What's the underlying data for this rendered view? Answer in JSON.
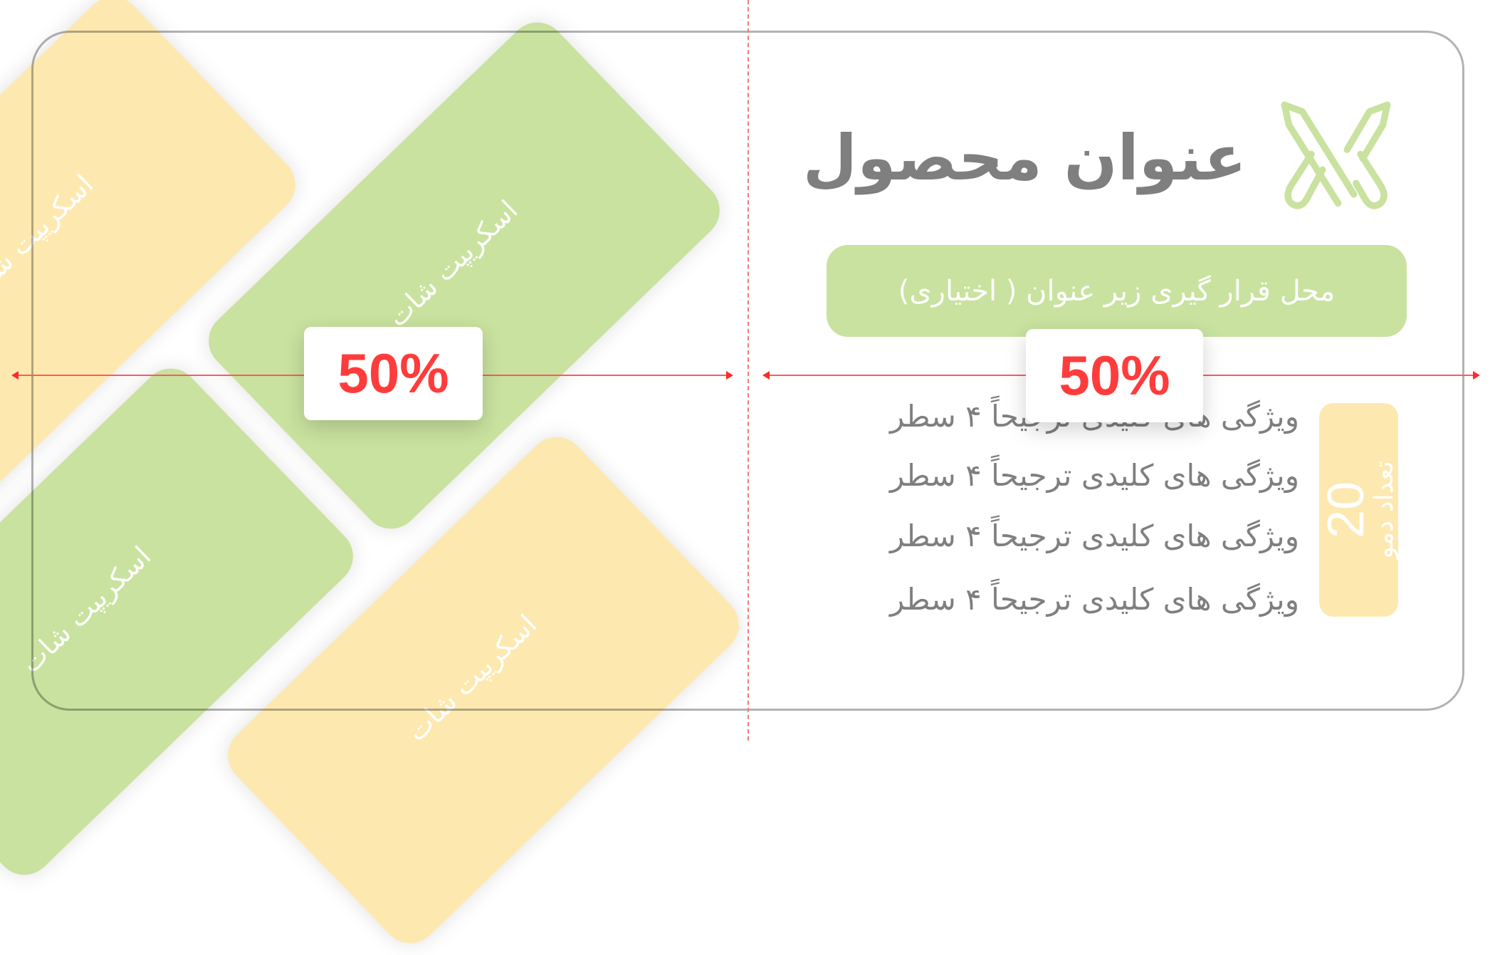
{
  "colors": {
    "green": "#c9e29f",
    "yellow": "#fde9b0",
    "title_gray": "#7f7f7f",
    "discount_red": "#ff3c3c",
    "guide_red": "#ff5a5a"
  },
  "tiles": [
    {
      "label": "اسکریپت شات",
      "color": "yellow"
    },
    {
      "label": "اسکریپت شات",
      "color": "green"
    },
    {
      "label": "اسکریپت شات",
      "color": "green"
    },
    {
      "label": "اسکریپت شات",
      "color": "yellow"
    }
  ],
  "left_badge": {
    "discount": "50%"
  },
  "right_badge": {
    "discount": "50%"
  },
  "product": {
    "icon": "crossed-swords-icon",
    "title": "عنوان محصول",
    "subtitle": "محل قرار گیری زیر عنوان ( اختیاری)",
    "features": [
      "ویژگی های کلیدی ترجیحاً ۴ سطر",
      "ویژگی های کلیدی ترجیحاً ۴ سطر",
      "ویژگی های کلیدی ترجیحاً ۴ سطر",
      "ویژگی های کلیدی ترجیحاً ۴ سطر"
    ],
    "demo_count": {
      "value": "20",
      "label": "تعداد دمو"
    }
  }
}
